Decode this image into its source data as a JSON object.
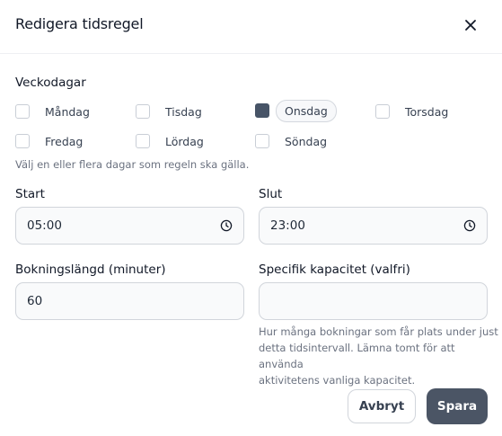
{
  "dialog": {
    "title": "Redigera tidsregel",
    "close_icon": "close-icon"
  },
  "weekdays": {
    "label": "Veckodagar",
    "days": [
      {
        "label": "Måndag",
        "checked": false
      },
      {
        "label": "Tisdag",
        "checked": false
      },
      {
        "label": "Onsdag",
        "checked": true
      },
      {
        "label": "Torsdag",
        "checked": false
      },
      {
        "label": "Fredag",
        "checked": false
      },
      {
        "label": "Lördag",
        "checked": false
      },
      {
        "label": "Söndag",
        "checked": false
      }
    ],
    "hint": "Välj en eller flera dagar som regeln ska gälla."
  },
  "start": {
    "label": "Start",
    "value": "05:00"
  },
  "end": {
    "label": "Slut",
    "value": "23:00"
  },
  "duration": {
    "label": "Bokningslängd (minuter)",
    "value": "60"
  },
  "capacity": {
    "label": "Specifik kapacitet (valfri)",
    "value": "",
    "hint_lines": [
      "Hur många bokningar som får plats under just",
      "detta tidsintervall. Lämna tomt för att använda",
      "aktivitetens vanliga kapacitet."
    ]
  },
  "actions": {
    "cancel": "Avbryt",
    "save": "Spara"
  },
  "colors": {
    "accent": "#4b5565",
    "checked": "#475467"
  }
}
